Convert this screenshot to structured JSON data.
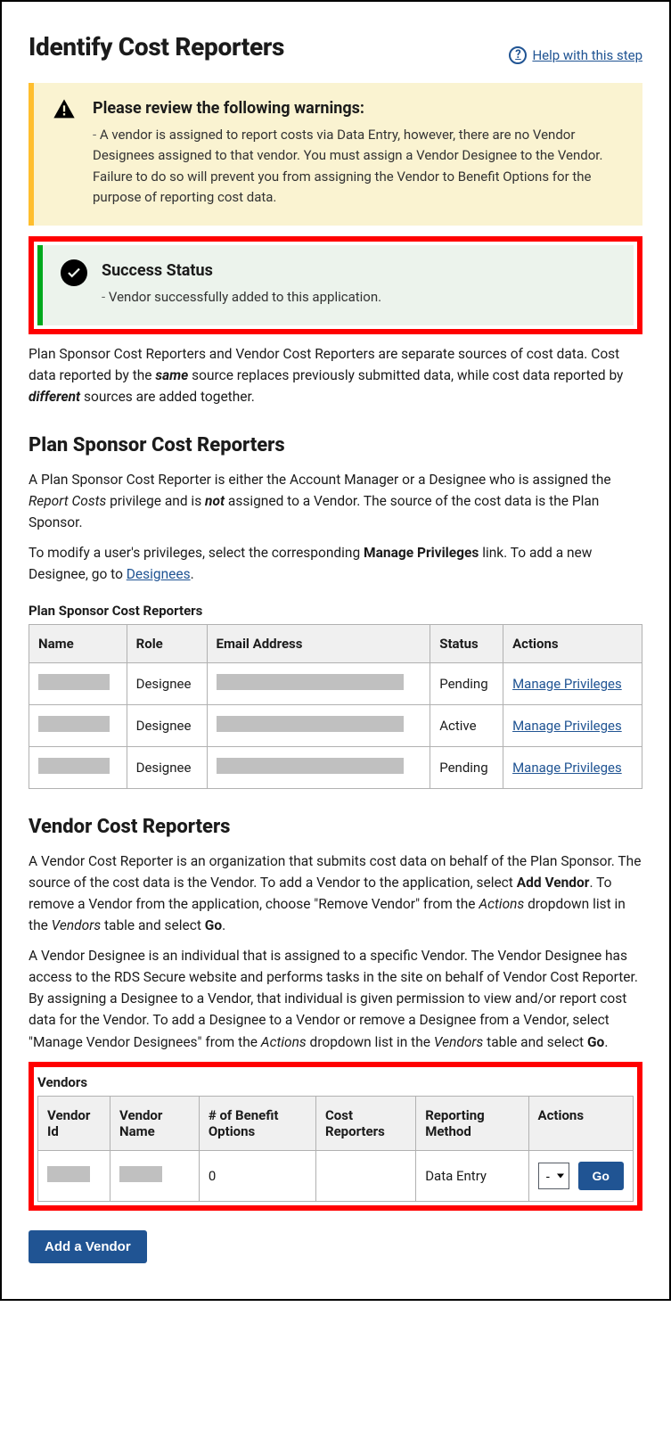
{
  "header": {
    "title": "Identify Cost Reporters",
    "help_label": "Help with this step"
  },
  "alert_warning": {
    "title": "Please review the following warnings:",
    "message": "A vendor is assigned to report costs via Data Entry, however, there are no Vendor Designees assigned to that vendor. You must assign a Vendor Designee to the Vendor. Failure to do so will prevent you from assigning the Vendor to Benefit Options for the purpose of reporting cost data."
  },
  "alert_success": {
    "title": "Success Status",
    "message": "Vendor successfully added to this application."
  },
  "intro_para_pre": "Plan Sponsor Cost Reporters and Vendor Cost Reporters are separate sources of cost data. Cost data reported by the ",
  "intro_same": "same",
  "intro_mid": " source replaces previously submitted data, while cost data reported by ",
  "intro_diff": "different",
  "intro_post": " sources are added together.",
  "ps_heading": "Plan Sponsor Cost Reporters",
  "ps_p1_pre": "A Plan Sponsor Cost Reporter is either the Account Manager or a Designee who is assigned the ",
  "ps_p1_em1": "Report Costs",
  "ps_p1_mid": " privilege and is ",
  "ps_p1_not": "not",
  "ps_p1_post": " assigned to a Vendor. The source of the cost data is the Plan Sponsor.",
  "ps_p2_pre": "To modify a user's privileges, select the corresponding ",
  "ps_p2_b": "Manage Privileges",
  "ps_p2_mid": " link. To add a new Designee, go to ",
  "ps_p2_link": "Designees",
  "ps_p2_post": ".",
  "ps_table": {
    "caption": "Plan Sponsor Cost Reporters",
    "headers": {
      "name": "Name",
      "role": "Role",
      "email": "Email Address",
      "status": "Status",
      "actions": "Actions"
    },
    "action_label": "Manage Privileges",
    "rows": [
      {
        "role": "Designee",
        "status": "Pending"
      },
      {
        "role": "Designee",
        "status": "Active"
      },
      {
        "role": "Designee",
        "status": "Pending"
      }
    ]
  },
  "vc_heading": "Vendor Cost Reporters",
  "vc_p1_pre": "A Vendor Cost Reporter is an organization that submits cost data on behalf of the Plan Sponsor. The source of the cost data is the Vendor. To add a Vendor to the application, select ",
  "vc_p1_b1": "Add Vendor",
  "vc_p1_mid1": ". To remove a Vendor from the application, choose \"Remove Vendor\" from the ",
  "vc_p1_em1": "Actions",
  "vc_p1_mid2": " dropdown list in the ",
  "vc_p1_em2": "Vendors",
  "vc_p1_mid3": " table and select ",
  "vc_p1_b2": "Go",
  "vc_p1_post": ".",
  "vc_p2_pre": "A Vendor Designee is an individual that is assigned to a specific Vendor. The Vendor Designee has access to the RDS Secure website and performs tasks in the site on behalf of Vendor Cost Reporter. By assigning a Designee to a Vendor, that individual is given permission to view and/or report cost data for the Vendor. To add a Designee to a Vendor or remove a Designee from a Vendor, select \"Manage Vendor Designees\" from the ",
  "vc_p2_em1": "Actions",
  "vc_p2_mid1": " dropdown list in the ",
  "vc_p2_em2": "Vendors",
  "vc_p2_mid2": " table and select ",
  "vc_p2_b1": "Go",
  "vc_p2_post": ".",
  "vendors_table": {
    "caption": "Vendors",
    "headers": {
      "id": "Vendor Id",
      "name": "Vendor Name",
      "opts": "# of Benefit Options",
      "cr": "Cost Reporters",
      "method": "Reporting Method",
      "actions": "Actions"
    },
    "row": {
      "opts": "0",
      "cr": "",
      "method": "Data Entry",
      "select": "-",
      "go": "Go"
    }
  },
  "add_vendor_label": "Add a Vendor"
}
